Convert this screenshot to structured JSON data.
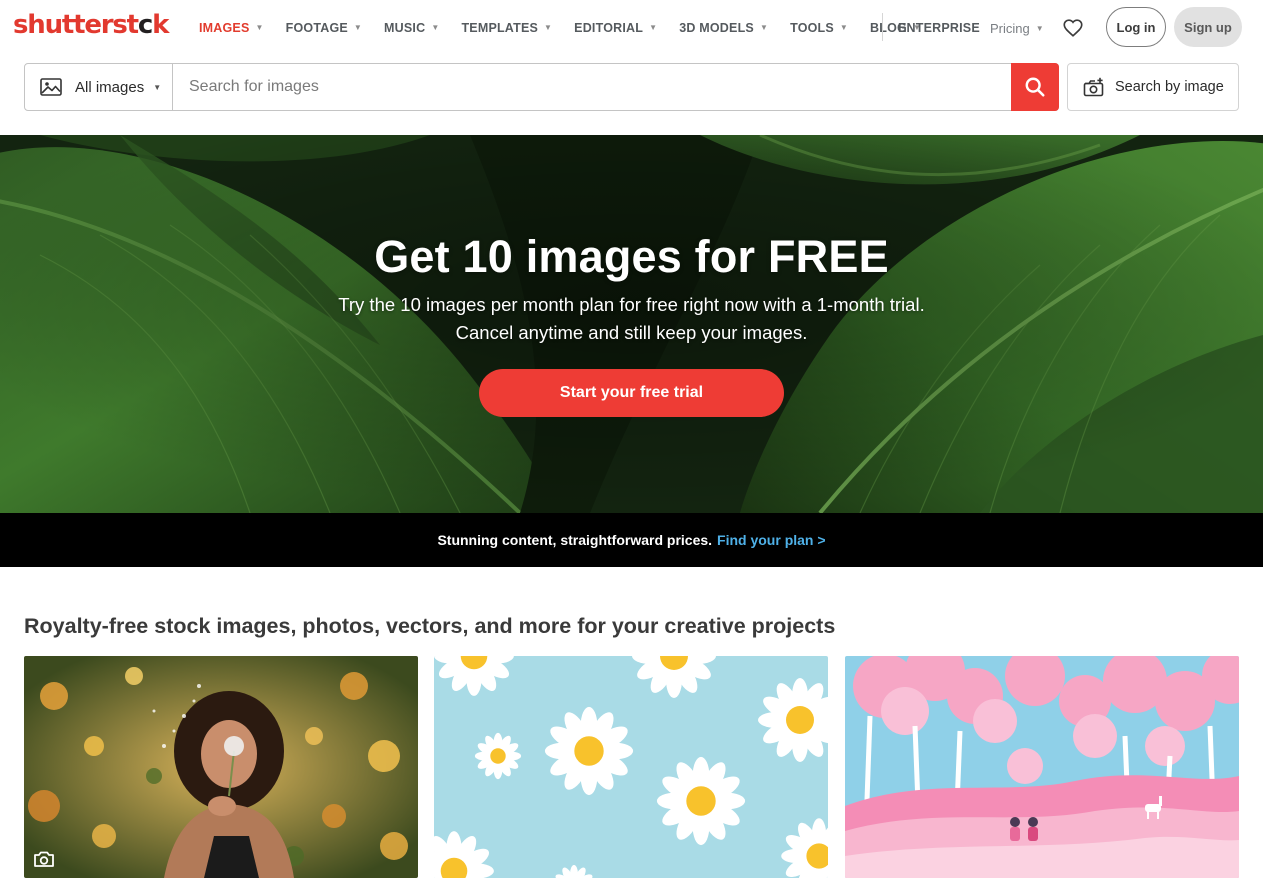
{
  "brand": {
    "logo_text_1": "shutterst",
    "logo_text_2": "c",
    "logo_text_3": "k"
  },
  "nav": {
    "items": [
      {
        "label": "IMAGES",
        "active": true
      },
      {
        "label": "FOOTAGE"
      },
      {
        "label": "MUSIC"
      },
      {
        "label": "TEMPLATES"
      },
      {
        "label": "EDITORIAL"
      },
      {
        "label": "3D MODELS"
      },
      {
        "label": "TOOLS"
      },
      {
        "label": "BLOG"
      }
    ],
    "enterprise": "ENTERPRISE",
    "pricing": "Pricing",
    "login": "Log in",
    "signup": "Sign up"
  },
  "search": {
    "type_label": "All images",
    "placeholder": "Search for images",
    "by_image_label": "Search by image"
  },
  "hero": {
    "title": "Get 10 images for FREE",
    "subtitle_line1": "Try the 10 images per month plan for free right now with a 1-month trial.",
    "subtitle_line2": "Cancel anytime and still keep your images.",
    "cta": "Start your free trial"
  },
  "promo": {
    "text": "Stunning content, straightforward prices.",
    "link": "Find your plan >"
  },
  "section": {
    "title": "Royalty-free stock images, photos, vectors, and more for your creative projects"
  },
  "colors": {
    "accent": "#ee3c35",
    "link": "#4fb1e8",
    "promo_bg": "#000000"
  },
  "icons": [
    "image-icon",
    "search-icon",
    "camera-search-icon",
    "heart-icon",
    "camera-icon",
    "chevron-down-icon"
  ]
}
